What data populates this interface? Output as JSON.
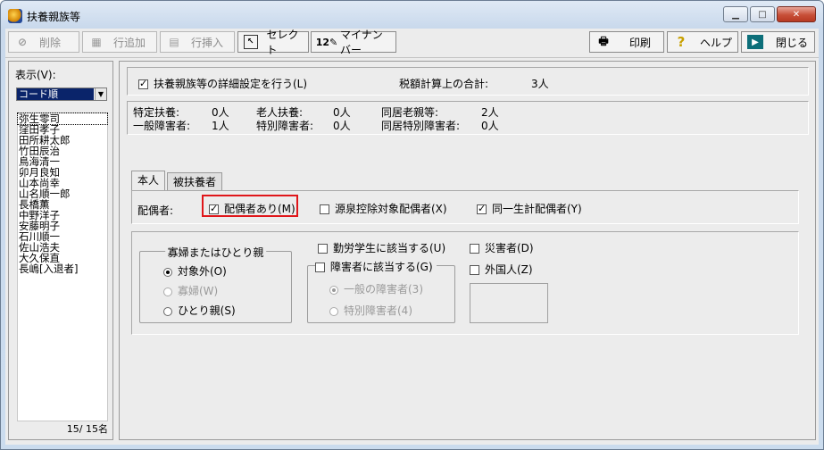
{
  "window": {
    "title": "扶養親族等",
    "controls": [
      "minimize",
      "maximize",
      "close"
    ]
  },
  "toolbar": {
    "delete": "削除",
    "add_row": "行追加",
    "insert_row": "行挿入",
    "select": "セレクト",
    "my_number": "マイナンバー",
    "print": "印刷",
    "help": "ヘルプ",
    "close": "閉じる"
  },
  "left": {
    "display_label": "表示(V):",
    "sort_value": "コード順",
    "names": [
      "弥生零司",
      "窪田孝子",
      "田所耕太郎",
      "竹田辰治",
      "鳥海清一",
      "卯月良知",
      "山本尚幸",
      "山名順一郎",
      "長橋薫",
      "中野洋子",
      "安藤明子",
      "石川順一",
      "佐山浩夫",
      "大久保直",
      "長嶋[入退者]"
    ],
    "counter": "15/  15名"
  },
  "main": {
    "detail_setting": "扶養親族等の詳細設定を行う(L)",
    "tax_total_label": "税額計算上の合計:",
    "tax_total_value": "3人",
    "stats": {
      "specific_label": "特定扶養:",
      "specific_value": "0人",
      "elderly_label": "老人扶養:",
      "elderly_value": "0人",
      "cohabit_elderly_label": "同居老親等:",
      "cohabit_elderly_value": "2人",
      "general_disabled_label": "一般障害者:",
      "general_disabled_value": "1人",
      "special_disabled_label": "特別障害者:",
      "special_disabled_value": "0人",
      "cohabit_special_label": "同居特別障害者:",
      "cohabit_special_value": "0人"
    },
    "tabs": [
      "本人",
      "被扶養者"
    ],
    "spouse_label": "配偶者:",
    "spouse_has": "配偶者あり(M)",
    "spouse_withholding": "源泉控除対象配偶者(X)",
    "spouse_same_household": "同一生計配偶者(Y)",
    "widow_group": {
      "title": "寡婦またはひとり親",
      "options": [
        "対象外(O)",
        "寡婦(W)",
        "ひとり親(S)"
      ]
    },
    "working_student": "勤労学生に該当する(U)",
    "disabled_check": "障害者に該当する(G)",
    "disabled_options": [
      "一般の障害者(3)",
      "特別障害者(4)"
    ],
    "disaster": "災害者(D)",
    "foreigner": "外国人(Z)"
  }
}
